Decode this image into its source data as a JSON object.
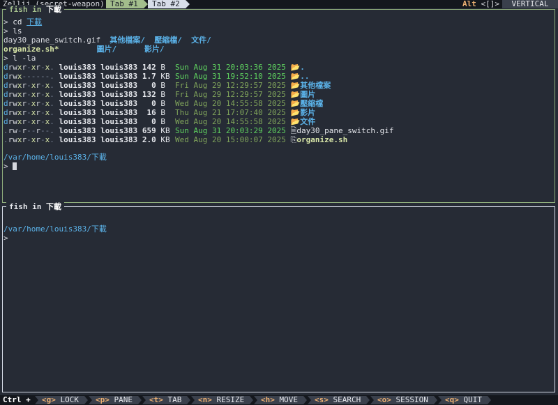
{
  "topbar": {
    "title": "Zellij (secret-weapon)",
    "tabs": [
      "Tab #1",
      "Tab #2"
    ],
    "swap_prefix": "Alt",
    "swap_keys": "<[]>",
    "layout": "VERTICAL"
  },
  "pane1": {
    "title": "fish in",
    "title_dir": "下載",
    "lines": {
      "cd_prompt": ">",
      "cd_cmd": "cd",
      "cd_arg": "下載",
      "ls_prompt": ">",
      "ls_cmd": "ls",
      "ls_row1": {
        "gif": "day30_pane_switch.gif",
        "d1": "其他檔案/",
        "d2": "壓縮檔/",
        "d3": "文件/"
      },
      "ls_row2": {
        "sh": "organize.sh*",
        "d4": "圖片/",
        "d5": "影片/"
      },
      "la_prompt": ">",
      "la_cmd": "l -la"
    },
    "entries": [
      {
        "perm": "drwxr-xr-x.",
        "user": "louis383",
        "group": "louis383",
        "size": "142",
        "unit": "B",
        "date": "Sun Aug 31 20:03:36 2025",
        "new": true,
        "icon": "folder-open-icon",
        "name": "."
      },
      {
        "perm": "drwx------.",
        "user": "louis383",
        "group": "louis383",
        "size": "1.7",
        "unit": "KB",
        "date": "Sun Aug 31 19:52:10 2025",
        "new": true,
        "icon": "folder-open-icon",
        "name": ".."
      },
      {
        "perm": "drwxr-xr-x.",
        "user": "louis383",
        "group": "louis383",
        "size": "0",
        "unit": "B",
        "date": "Fri Aug 29 12:29:57 2025",
        "new": false,
        "icon": "folder-open-icon",
        "name": "其他檔案"
      },
      {
        "perm": "drwxr-xr-x.",
        "user": "louis383",
        "group": "louis383",
        "size": "132",
        "unit": "B",
        "date": "Fri Aug 29 12:29:57 2025",
        "new": false,
        "icon": "folder-open-icon",
        "name": "圖片"
      },
      {
        "perm": "drwxr-xr-x.",
        "user": "louis383",
        "group": "louis383",
        "size": "0",
        "unit": "B",
        "date": "Wed Aug 20 14:55:58 2025",
        "new": false,
        "icon": "folder-open-icon",
        "name": "壓縮檔"
      },
      {
        "perm": "drwxr-xr-x.",
        "user": "louis383",
        "group": "louis383",
        "size": "16",
        "unit": "B",
        "date": "Thu Aug 21 17:07:40 2025",
        "new": false,
        "icon": "folder-open-icon",
        "name": "影片"
      },
      {
        "perm": "drwxr-xr-x.",
        "user": "louis383",
        "group": "louis383",
        "size": "0",
        "unit": "B",
        "date": "Wed Aug 20 14:55:58 2025",
        "new": false,
        "icon": "folder-open-icon",
        "name": "文件"
      },
      {
        "perm": ".rw-r--r--.",
        "user": "louis383",
        "group": "louis383",
        "size": "659",
        "unit": "KB",
        "date": "Sun Aug 31 20:03:29 2025",
        "new": true,
        "icon": "file-icon",
        "name": "day30_pane_switch.gif"
      },
      {
        "perm": ".rwxr-xr-x.",
        "user": "louis383",
        "group": "louis383",
        "size": "2.0",
        "unit": "KB",
        "date": "Wed Aug 20 15:00:07 2025",
        "new": false,
        "icon": "terminal-file-icon",
        "name": "organize.sh"
      }
    ],
    "cwd": "/var/home/louis383/下載",
    "prompt": ">"
  },
  "pane2": {
    "title": "fish in",
    "title_dir": "下載",
    "cwd": "/var/home/louis383/下載",
    "prompt": ">"
  },
  "bottombar": {
    "modifier": "Ctrl +",
    "keys": [
      {
        "key": "<g>",
        "label": "LOCK"
      },
      {
        "key": "<p>",
        "label": "PANE"
      },
      {
        "key": "<t>",
        "label": "TAB"
      },
      {
        "key": "<n>",
        "label": "RESIZE"
      },
      {
        "key": "<h>",
        "label": "MOVE"
      },
      {
        "key": "<s>",
        "label": "SEARCH"
      },
      {
        "key": "<o>",
        "label": "SESSION"
      },
      {
        "key": "<q>",
        "label": "QUIT"
      }
    ]
  },
  "colors": {
    "background": "#262b35",
    "active_pane_border": "#8fae7c",
    "inactive_pane_border": "#d8dee9",
    "directory": "#5bb2e8",
    "recent_date": "#5fd35f"
  }
}
